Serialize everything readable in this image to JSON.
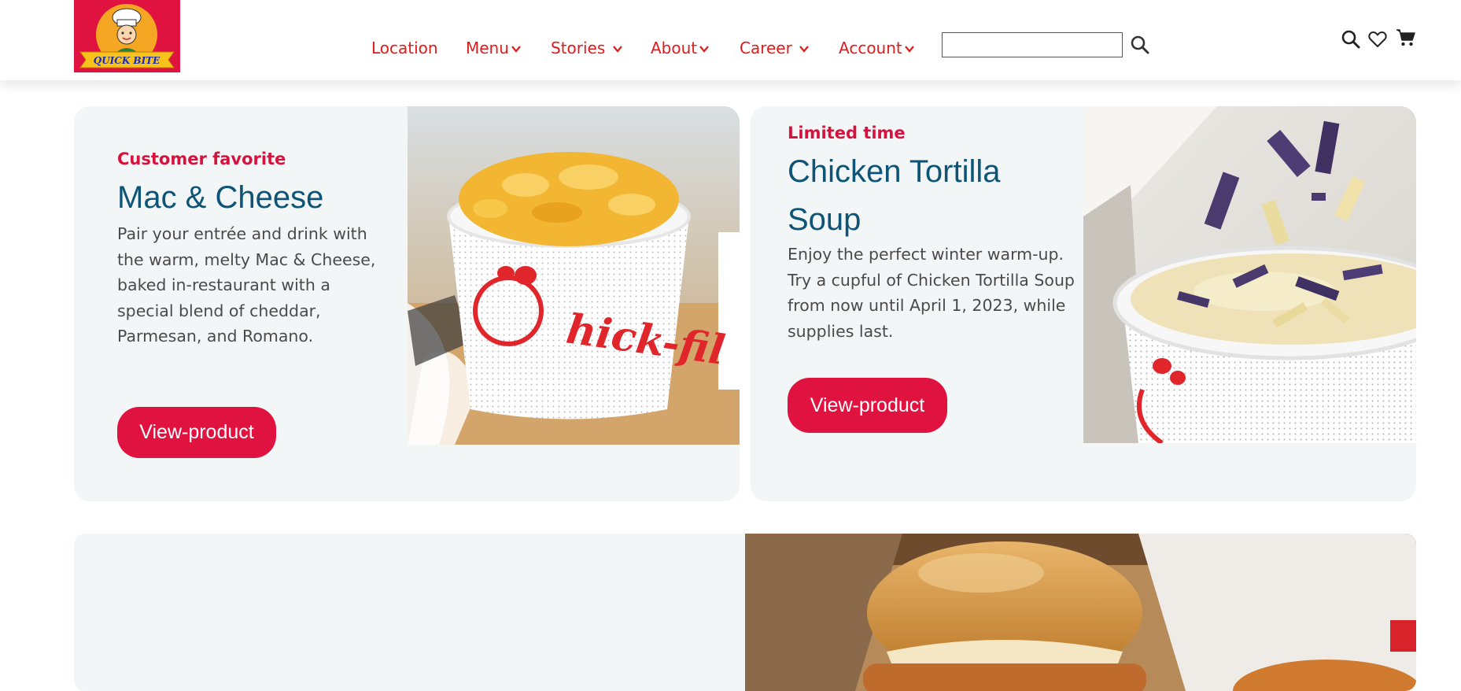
{
  "brand": {
    "logo_text": "QUICK BITE",
    "accent": "#e01340",
    "nav_color": "#e01b1b",
    "title_color": "#0e5477"
  },
  "nav": {
    "items": [
      {
        "label": "Location",
        "dropdown": false
      },
      {
        "label": "Menu",
        "dropdown": true
      },
      {
        "label": "Stories",
        "dropdown": true
      },
      {
        "label": "About",
        "dropdown": true
      },
      {
        "label": "Career",
        "dropdown": true
      },
      {
        "label": "Account",
        "dropdown": true
      }
    ],
    "search": {
      "value": "",
      "icon": "search-icon"
    }
  },
  "header_icons": [
    "search-icon",
    "heart-icon",
    "cart-icon"
  ],
  "cards": [
    {
      "kicker": "Customer favorite",
      "title": "Mac & Cheese",
      "description": "Pair your entrée and drink with the warm, melty Mac & Cheese, baked in-restaurant with a special blend of cheddar, Parmesan, and Romano.",
      "button": "View-product"
    },
    {
      "kicker": "Limited time",
      "title": "Chicken Tortilla Soup",
      "description": "Enjoy the perfect winter warm-up. Try a cupful of Chicken Tortilla Soup from now until April 1, 2023, while supplies last.",
      "button": "View-product"
    }
  ]
}
